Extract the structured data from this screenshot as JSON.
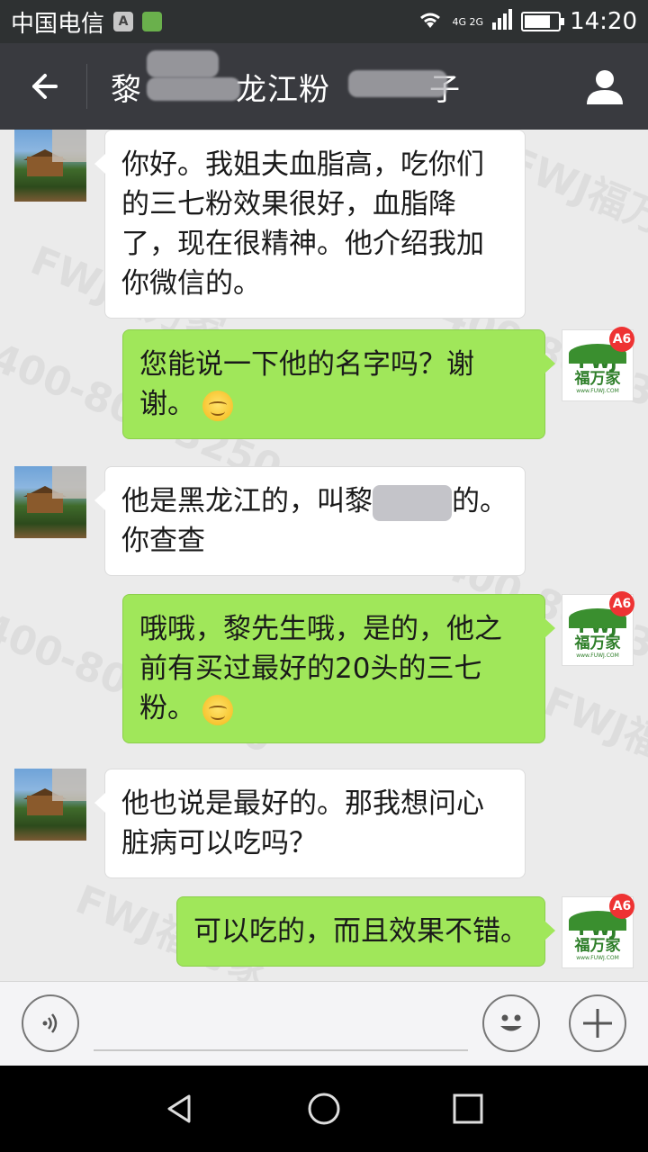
{
  "status_bar": {
    "carrier": "中国电信",
    "network": "4G 2G",
    "time": "14:20",
    "a_label": "A"
  },
  "header": {
    "title_part1": "黎",
    "title_part2": "龙江粉",
    "title_part3": "子"
  },
  "messages": [
    {
      "side": "left",
      "text": "你好。我姐夫血脂高，吃你们的三七粉效果很好，血脂降了，现在很精神。他介绍我加你微信的。"
    },
    {
      "side": "right",
      "text": "您能说一下他的名字吗？谢谢。"
    },
    {
      "side": "left",
      "text_before": "他是黑龙江的，叫黎",
      "text_after": "的。你查查"
    },
    {
      "side": "right",
      "text": "哦哦，黎先生哦，是的，他之前有买过最好的20头的三七粉。"
    },
    {
      "side": "left",
      "text": "他也说是最好的。那我想问心脏病可以吃吗？"
    },
    {
      "side": "right",
      "text": "可以吃的，而且效果不错。"
    }
  ],
  "avatar_right": {
    "letters": "FWJ",
    "chinese": "福万家",
    "url": "www.FUWJ.COM",
    "badge": "A6"
  },
  "watermark": {
    "phone": "400-800-3250",
    "brand": "FWJ福万家"
  },
  "icons": {
    "back": "arrow-left-icon",
    "profile": "person-icon",
    "voice": "voice-icon",
    "emoji": "smiley-icon",
    "plus": "plus-icon"
  }
}
